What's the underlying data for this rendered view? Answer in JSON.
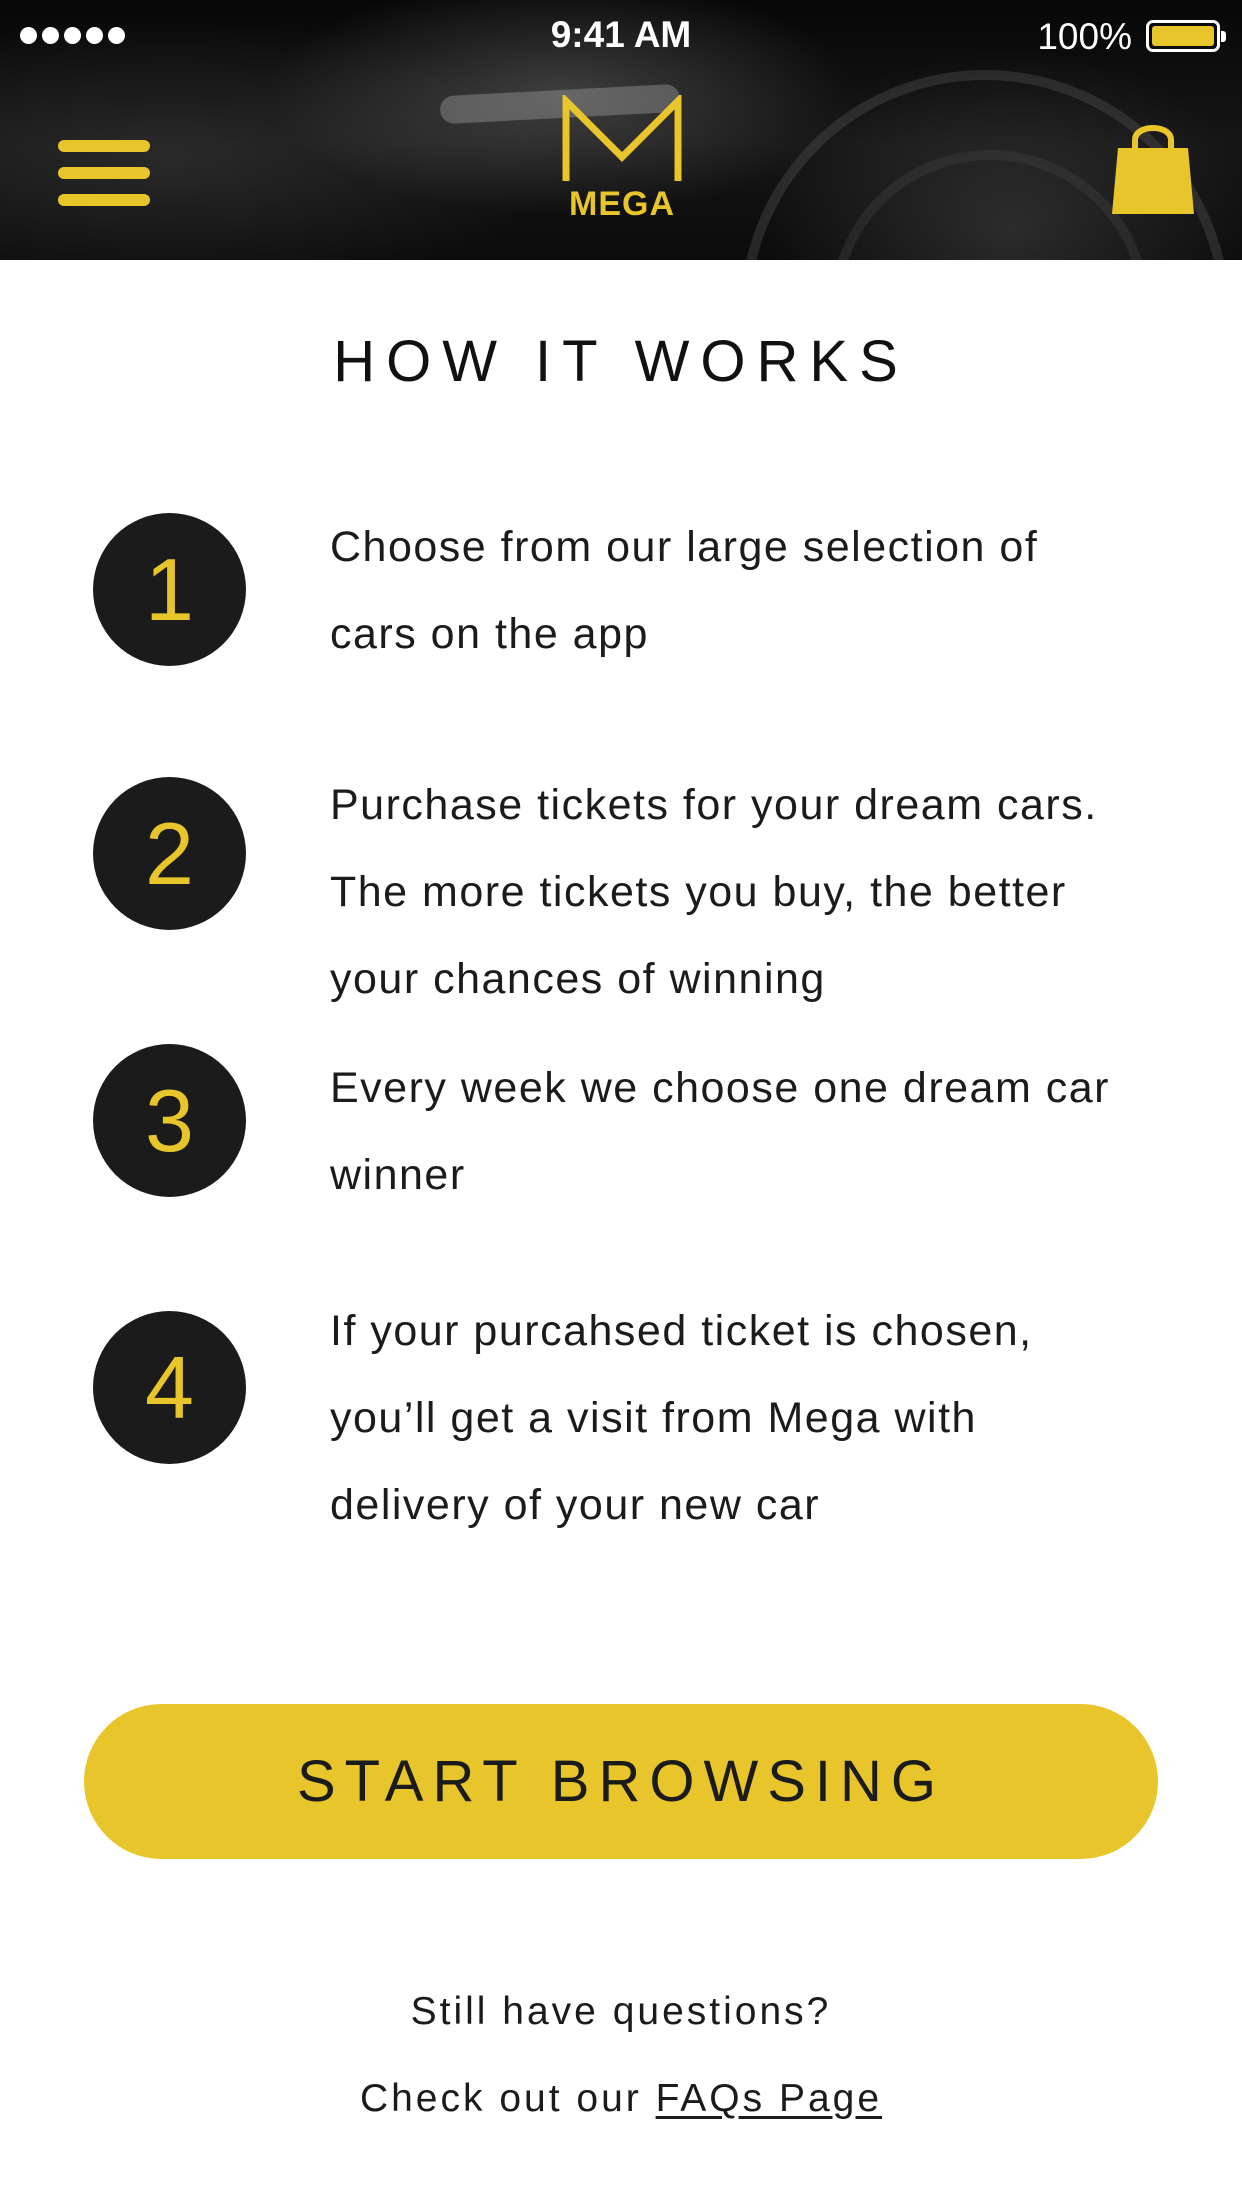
{
  "status_bar": {
    "time": "9:41 AM",
    "battery_percent": "100%",
    "signal_bars": 5,
    "battery_level": 1.0
  },
  "header": {
    "logo_letter": "M",
    "logo_text": "MEGA",
    "menu_icon": "hamburger-menu-icon",
    "cart_icon": "shopping-bag-icon"
  },
  "page": {
    "title": "HOW IT WORKS"
  },
  "steps": [
    {
      "number": "1",
      "text": "Choose from our large selection of cars on the app"
    },
    {
      "number": "2",
      "text": "Purchase tickets for your dream cars. The more tickets you buy, the better your chances of winning"
    },
    {
      "number": "3",
      "text": "Every week we choose one dream car winner"
    },
    {
      "number": "4",
      "text": "If your purcahsed ticket is chosen, you’ll get a visit from Mega with delivery of your new car"
    }
  ],
  "cta": {
    "label": "START BROWSING"
  },
  "help": {
    "question": "Still have questions?",
    "prefix": "Check out our ",
    "link_label": "FAQs Page"
  },
  "colors": {
    "accent": "#e8c52a",
    "dark": "#1b1b1b",
    "background": "#ffffff"
  }
}
